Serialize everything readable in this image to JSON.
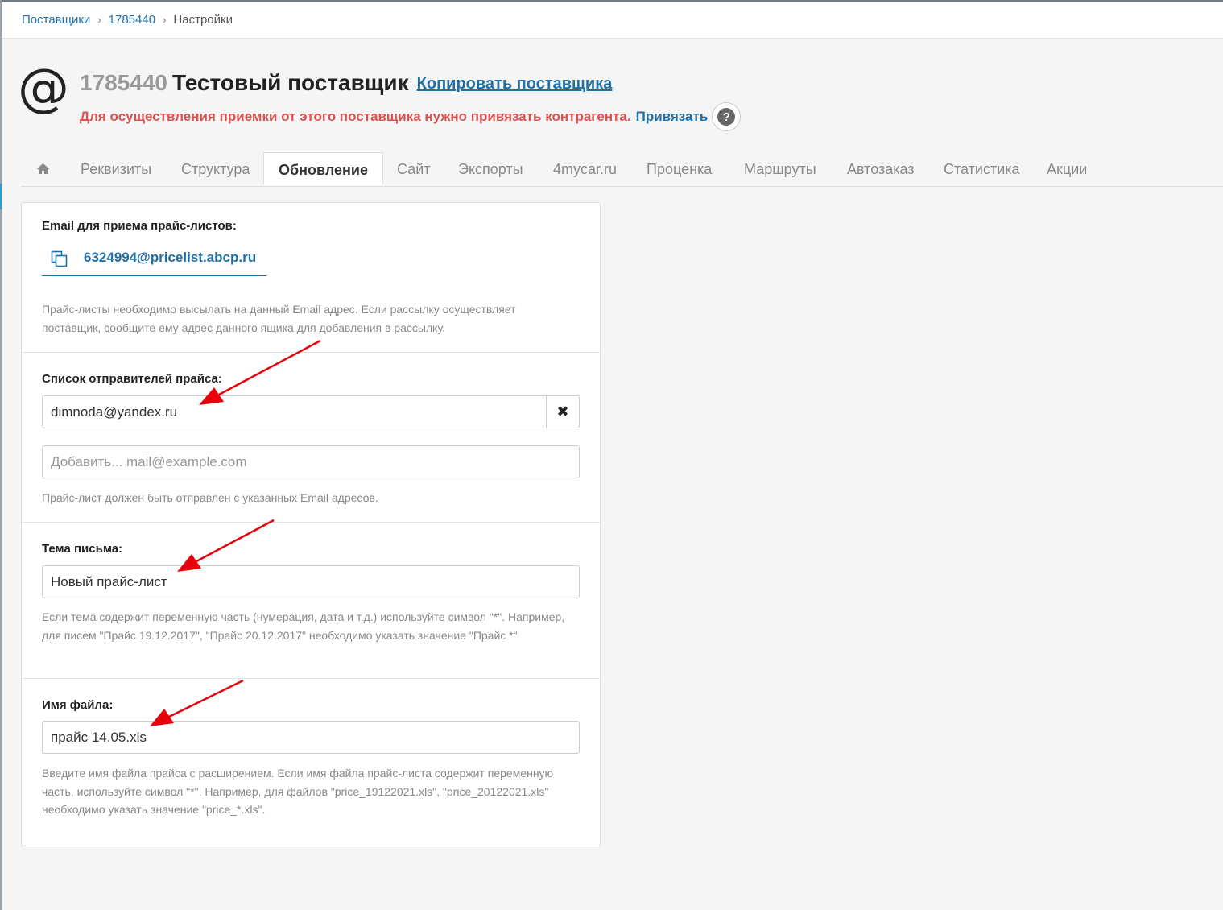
{
  "breadcrumb": {
    "items": [
      "Поставщики",
      "1785440"
    ],
    "separator": "›",
    "current": "Настройки"
  },
  "header": {
    "icon_char": "@",
    "supplier_id": "1785440",
    "supplier_name": "Тестовый поставщик",
    "copy_link": "Копировать поставщика",
    "warning": "Для осуществления приемки от этого поставщика нужно привязать контрагента.",
    "bind_link": "Привязать",
    "help_char": "?"
  },
  "tabs": {
    "home_icon": "home-icon",
    "items": [
      "Реквизиты",
      "Структура",
      "Обновление",
      "Сайт",
      "Экспорты",
      "4mycar.ru",
      "Проценка",
      "Маршруты",
      "Автозаказ",
      "Статистика",
      "Акции"
    ],
    "active": "Обновление"
  },
  "form": {
    "email_section": {
      "label": "Email для приема прайс-листов:",
      "email": "6324994@pricelist.abcp.ru",
      "hint": "Прайс-листы необходимо высылать на данный Email адрес. Если рассылку осуществляет поставщик, сообщите ему адрес данного ящика для добавления в рассылку."
    },
    "senders_section": {
      "label": "Список отправителей прайса:",
      "sender_value": "dimnoda@yandex.ru",
      "remove_char": "✖",
      "add_placeholder": "Добавить... mail@example.com",
      "hint": "Прайс-лист должен быть отправлен с указанных Email адресов."
    },
    "subject_section": {
      "label": "Тема письма:",
      "value": "Новый прайс-лист",
      "hint": "Если тема содержит переменную часть (нумерация, дата и т.д.) используйте символ \"*\". Например, для писем \"Прайс 19.12.2017\", \"Прайс 20.12.2017\" необходимо указать значение \"Прайс *\""
    },
    "filename_section": {
      "label": "Имя файла:",
      "value": "прайс 14.05.xls",
      "hint": "Введите имя файла прайса с расширением. Если имя файла прайс-листа содержит переменную часть, используйте символ \"*\". Например, для файлов \"price_19122021.xls\", \"price_20122021.xls\" необходимо указать значение \"price_*.xls\"."
    }
  },
  "colors": {
    "link": "#1f6fa8",
    "warning": "#d9534f",
    "annotation_arrow": "#e8000b"
  }
}
